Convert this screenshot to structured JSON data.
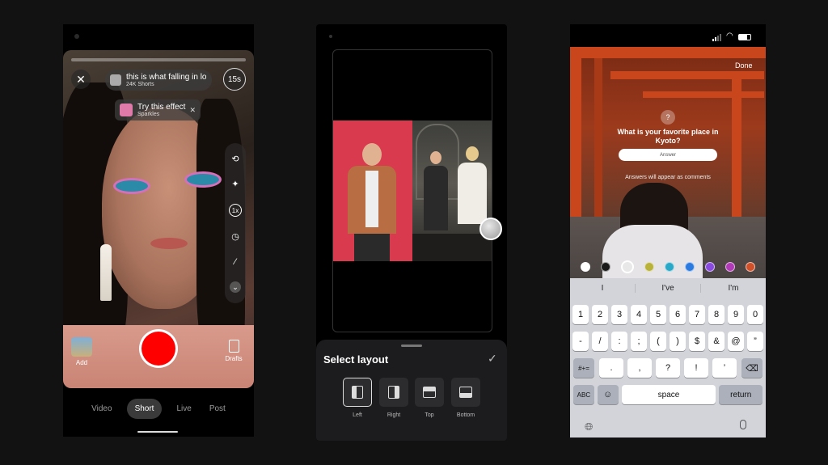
{
  "phone1": {
    "close_icon": "close-icon",
    "sound": {
      "title": "this is what falling in lo",
      "subtitle": "24K Shorts"
    },
    "timer": "15s",
    "effect": {
      "title": "Try this effect",
      "subtitle": "Sparkles"
    },
    "sidebar_icons": [
      "flip-camera-icon",
      "sparkle-effects-icon",
      "speed-icon",
      "timer-icon",
      "retouch-wand-icon",
      "chevron-down-icon"
    ],
    "speed_label": "1x",
    "add_label": "Add",
    "drafts_label": "Drafts",
    "modes": [
      "Video",
      "Short",
      "Live",
      "Post"
    ],
    "active_mode": "Short"
  },
  "phone2": {
    "sheet_title": "Select layout",
    "layouts": [
      "Left",
      "Right",
      "Top",
      "Bottom"
    ],
    "selected_layout": "Left"
  },
  "phone3": {
    "done": "Done",
    "question": "What is your favorite place in Kyoto?",
    "answer_placeholder": "Answer",
    "note": "Answers will appear as comments",
    "colors": [
      "#ffffff",
      "#1a1a1a",
      "#e8e8e8",
      "#b8b23a",
      "#2aa8c8",
      "#2a7ae0",
      "#8a4ae0",
      "#b03ab8",
      "#d0502a"
    ],
    "suggestions": [
      "I",
      "I've",
      "I'm"
    ],
    "keyboard": {
      "row1": [
        "1",
        "2",
        "3",
        "4",
        "5",
        "6",
        "7",
        "8",
        "9",
        "0"
      ],
      "row2": [
        "-",
        "/",
        ":",
        ";",
        "(",
        ")",
        "$",
        "&",
        "@",
        "”"
      ],
      "row3_left": "#+=",
      "row3": [
        ".",
        ",",
        "?",
        "!",
        "’"
      ],
      "row4_abc": "ABC",
      "space": "space",
      "return": "return"
    }
  }
}
